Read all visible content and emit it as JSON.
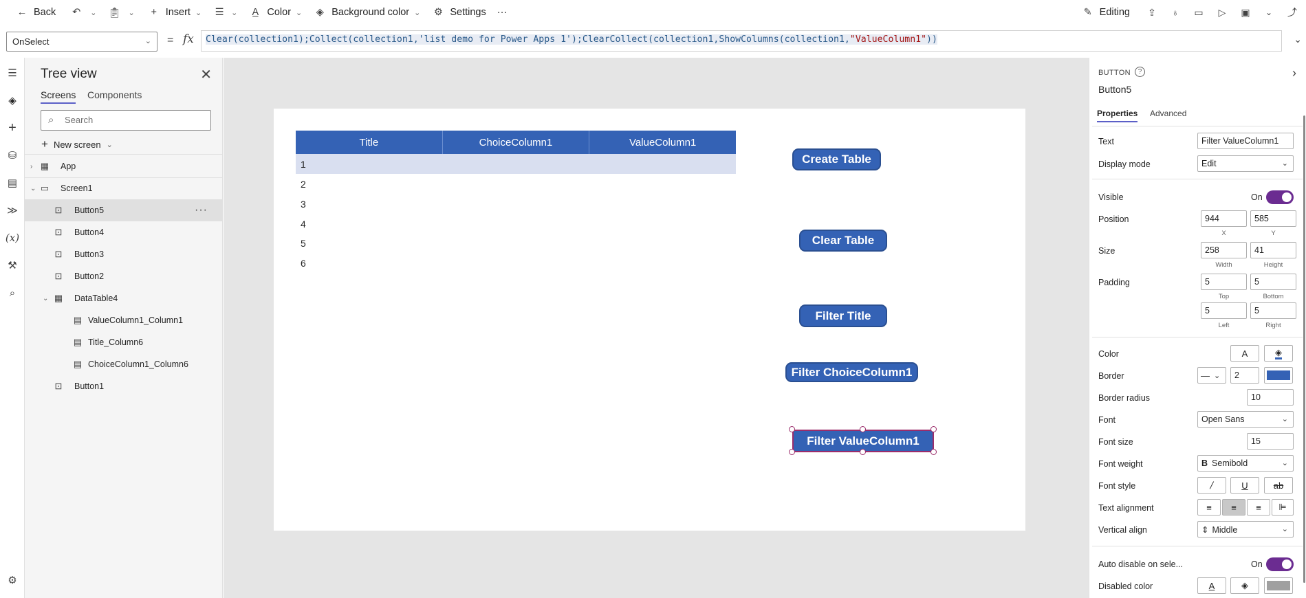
{
  "toolbar": {
    "back": "Back",
    "insert": "Insert",
    "color": "Color",
    "background_color": "Background color",
    "settings": "Settings",
    "more": "···",
    "editing": "Editing"
  },
  "formula": {
    "property": "OnSelect",
    "eq": "=",
    "fx": "fx",
    "p1": "Clear(collection1);Collect(collection1,'list demo for Power Apps 1');ClearCollect(collection1,ShowColumns(collection1,",
    "p2": "\"ValueColumn1\"",
    "p3": "))"
  },
  "tree": {
    "title": "Tree view",
    "tabs": [
      "Screens",
      "Components"
    ],
    "search_placeholder": "Search",
    "new_screen": "New screen",
    "items": [
      {
        "label": "App"
      },
      {
        "label": "Screen1"
      },
      {
        "label": "Button5"
      },
      {
        "label": "Button4"
      },
      {
        "label": "Button3"
      },
      {
        "label": "Button2"
      },
      {
        "label": "DataTable4"
      },
      {
        "label": "ValueColumn1_Column1"
      },
      {
        "label": "Title_Column6"
      },
      {
        "label": "ChoiceColumn1_Column6"
      },
      {
        "label": "Button1"
      }
    ]
  },
  "canvas": {
    "table": {
      "headers": [
        "Title",
        "ChoiceColumn1",
        "ValueColumn1"
      ],
      "rows": [
        "1",
        "2",
        "3",
        "4",
        "5",
        "6"
      ]
    },
    "buttons": [
      "Create Table",
      "Clear Table",
      "Filter Title",
      "Filter ChoiceColumn1",
      "Filter ValueColumn1"
    ]
  },
  "properties": {
    "type": "BUTTON",
    "name": "Button5",
    "tabs": [
      "Properties",
      "Advanced"
    ],
    "text_label": "Text",
    "text_value": "Filter ValueColumn1",
    "display_mode_label": "Display mode",
    "display_mode_value": "Edit",
    "visible_label": "Visible",
    "visible_value": "On",
    "position_label": "Position",
    "x": "944",
    "y": "585",
    "x_sub": "X",
    "y_sub": "Y",
    "size_label": "Size",
    "width": "258",
    "height": "41",
    "width_sub": "Width",
    "height_sub": "Height",
    "padding_label": "Padding",
    "pad_top": "5",
    "pad_bottom": "5",
    "pad_left": "5",
    "pad_right": "5",
    "top_sub": "Top",
    "bottom_sub": "Bottom",
    "left_sub": "Left",
    "right_sub": "Right",
    "color_label": "Color",
    "border_label": "Border",
    "border_width": "2",
    "border_radius_label": "Border radius",
    "border_radius": "10",
    "font_label": "Font",
    "font_value": "Open Sans",
    "font_size_label": "Font size",
    "font_size": "15",
    "font_weight_label": "Font weight",
    "font_weight": "Semibold",
    "font_style_label": "Font style",
    "text_alignment_label": "Text alignment",
    "vertical_align_label": "Vertical align",
    "vertical_align": "Middle",
    "auto_disable_label": "Auto disable on sele...",
    "auto_disable_value": "On",
    "disabled_color_label": "Disabled color"
  },
  "colors": {
    "accent": "#3462b5",
    "toggle": "#6b2c91",
    "canvas_bg": "#e5e5e5"
  }
}
